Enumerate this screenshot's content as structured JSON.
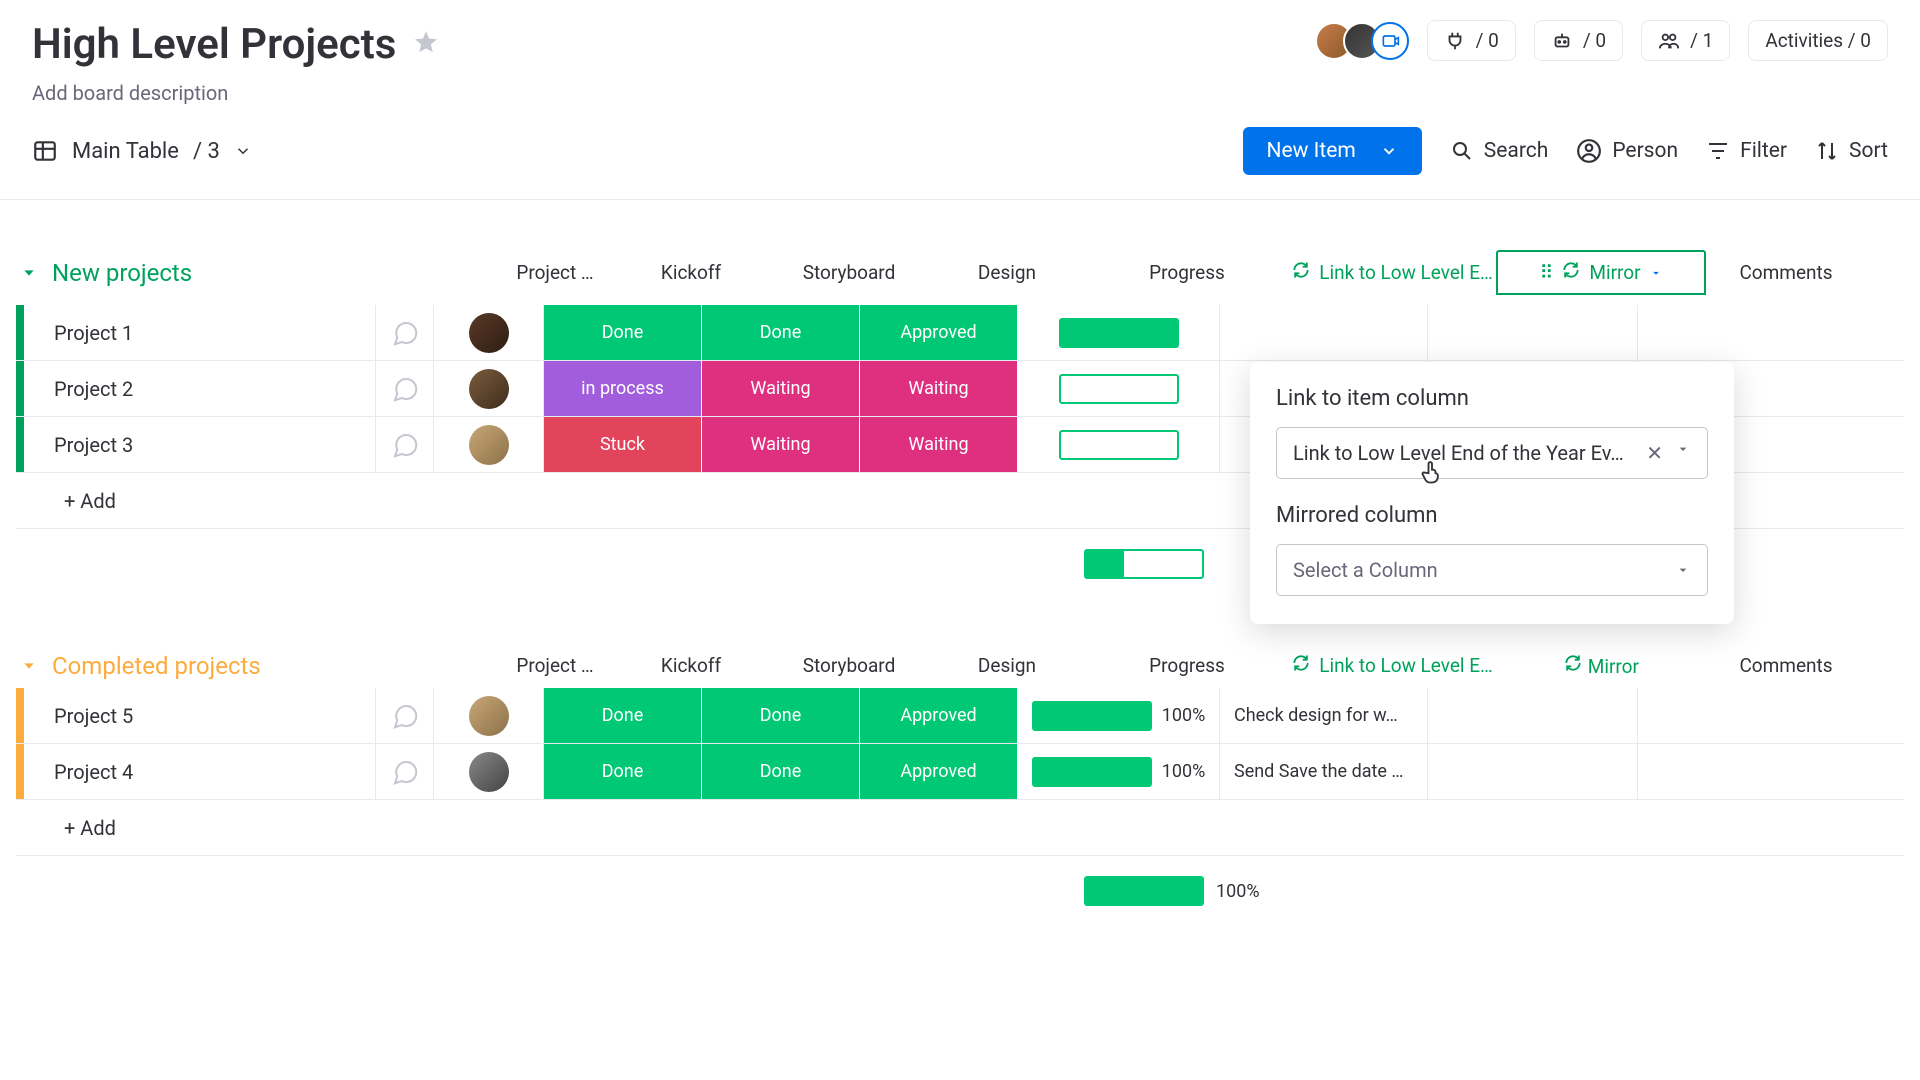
{
  "header": {
    "title": "High Level Projects",
    "description_placeholder": "Add board description",
    "people_count": "/ 1",
    "integrations_count": "/ 0",
    "automations_count": "/ 0",
    "activities_label": "Activities / 0"
  },
  "toolbar": {
    "view_name": "Main Table",
    "view_count": "/ 3",
    "new_item": "New Item",
    "search": "Search",
    "person": "Person",
    "filter": "Filter",
    "sort": "Sort"
  },
  "columns": {
    "owner": "Project …",
    "kickoff": "Kickoff",
    "storyboard": "Storyboard",
    "design": "Design",
    "progress": "Progress",
    "link": "Link to Low Level E…",
    "mirror": "Mirror",
    "comments": "Comments"
  },
  "groups": [
    {
      "name": "New projects",
      "color": "#00a25b",
      "border": "#00a25b",
      "summary_progress": 33,
      "rows": [
        {
          "name": "Project 1",
          "owner": "a",
          "kickoff": {
            "t": "Done",
            "c": "#00c875"
          },
          "storyboard": {
            "t": "Done",
            "c": "#00c875"
          },
          "design": {
            "t": "Approved",
            "c": "#00c875"
          },
          "progress": 100,
          "link": ""
        },
        {
          "name": "Project 2",
          "owner": "b",
          "kickoff": {
            "t": "in process",
            "c": "#a25ddc"
          },
          "storyboard": {
            "t": "Waiting",
            "c": "#df2f7f"
          },
          "design": {
            "t": "Waiting",
            "c": "#df2f7f"
          },
          "progress": 0,
          "link": ""
        },
        {
          "name": "Project 3",
          "owner": "c",
          "kickoff": {
            "t": "Stuck",
            "c": "#e2445c"
          },
          "storyboard": {
            "t": "Waiting",
            "c": "#df2f7f"
          },
          "design": {
            "t": "Waiting",
            "c": "#df2f7f"
          },
          "progress": 0,
          "link": ""
        }
      ],
      "add_label": "+ Add",
      "mirror_header_active": true
    },
    {
      "name": "Completed projects",
      "color": "#fdab3d",
      "border": "#fdab3d",
      "summary_progress": 100,
      "summary_progress_text": "100%",
      "rows": [
        {
          "name": "Project 5",
          "owner": "c",
          "kickoff": {
            "t": "Done",
            "c": "#00c875"
          },
          "storyboard": {
            "t": "Done",
            "c": "#00c875"
          },
          "design": {
            "t": "Approved",
            "c": "#00c875"
          },
          "progress": 100,
          "progress_text": "100%",
          "link": "Check design for w…"
        },
        {
          "name": "Project 4",
          "owner": "d",
          "kickoff": {
            "t": "Done",
            "c": "#00c875"
          },
          "storyboard": {
            "t": "Done",
            "c": "#00c875"
          },
          "design": {
            "t": "Approved",
            "c": "#00c875"
          },
          "progress": 100,
          "progress_text": "100%",
          "link": "Send Save the date …"
        }
      ],
      "add_label": "+ Add",
      "mirror_header_active": false
    }
  ],
  "popover": {
    "title1": "Link to item column",
    "value1": "Link to Low Level End of the Year Ev…",
    "title2": "Mirrored column",
    "placeholder2": "Select a Column"
  }
}
